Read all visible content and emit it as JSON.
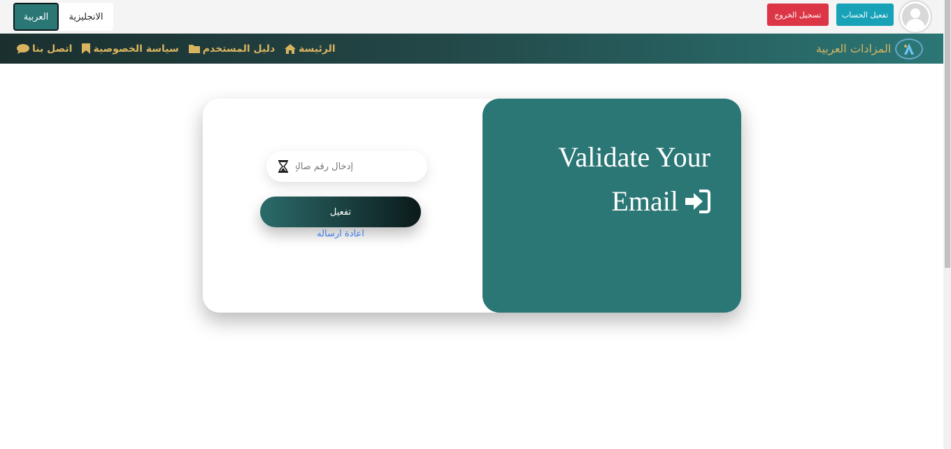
{
  "topbar": {
    "lang_arabic": "العربية",
    "lang_english": "الانجليزية",
    "logout_label": "تسجيل الخروج",
    "activate_account_label": "تفعيل الحساب",
    "colors": {
      "logout": "#dc3545",
      "activate": "#17a2b8",
      "active_lang": "#2b7776"
    }
  },
  "navbar": {
    "brand": "المزادات العربية",
    "items": [
      {
        "label": "الرئيسة",
        "icon": "home-icon"
      },
      {
        "label": "دليل المستخدم",
        "icon": "folder-icon"
      },
      {
        "label": "سياسة الخصوصية",
        "icon": "bookmark-icon"
      },
      {
        "label": "اتصل بنا",
        "icon": "comment-icon"
      }
    ],
    "text_color": "#d9b45f"
  },
  "card": {
    "title": "Validate Your Email",
    "title_icon": "sign-in-icon",
    "code_input_placeholder": "إدخال رقم صالح",
    "code_input_value": "",
    "input_icon": "hourglass-icon",
    "submit_label": "تفعيل",
    "resend_label": "اعادة ارساله",
    "panel_color": "#2b7776"
  }
}
